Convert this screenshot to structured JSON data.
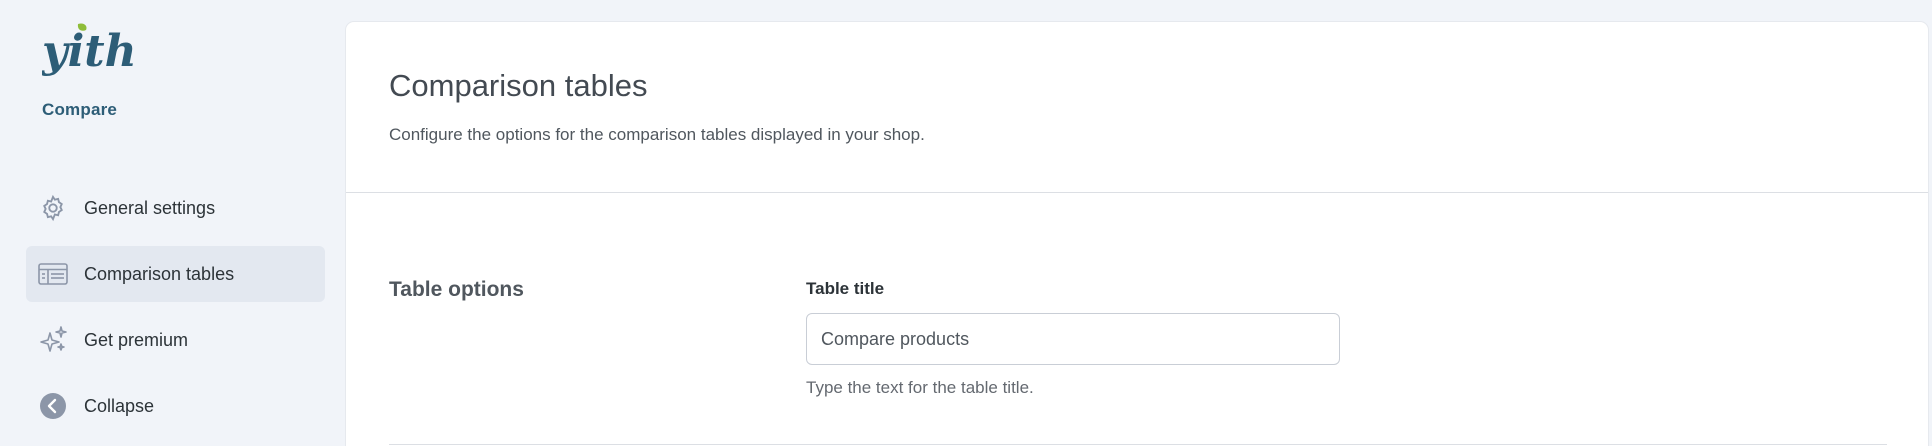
{
  "brand": {
    "logo_text": "yith",
    "name": "Compare"
  },
  "sidebar": {
    "items": [
      {
        "label": "General settings",
        "icon": "gear-icon"
      },
      {
        "label": "Comparison tables",
        "icon": "table-icon",
        "active": true
      },
      {
        "label": "Get premium",
        "icon": "sparkles-icon"
      },
      {
        "label": "Collapse",
        "icon": "collapse-arrow-icon"
      }
    ]
  },
  "header": {
    "title": "Comparison tables",
    "description": "Configure the options for the comparison tables displayed in your shop."
  },
  "section": {
    "title": "Table options",
    "field": {
      "label": "Table title",
      "value": "Compare products",
      "help": "Type the text for the table title."
    }
  },
  "colors": {
    "brand": "#2d5d77",
    "accent": "#8fbd3a",
    "sidebar_bg": "#f1f4f9",
    "active_item": "#e3e8f0"
  }
}
